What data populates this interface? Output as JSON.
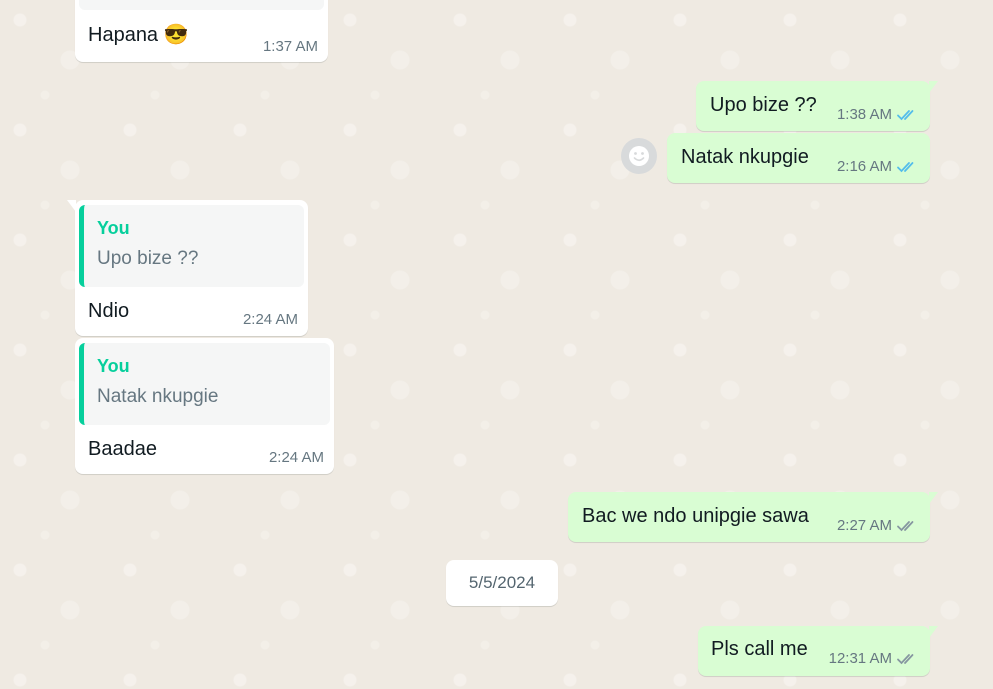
{
  "colors": {
    "background": "#efeae2",
    "incoming_bubble": "#ffffff",
    "outgoing_bubble": "#d9fdd3",
    "read_tick": "#53bdeb",
    "delivered_tick": "#8696a0",
    "quote_accent": "#06cf9c"
  },
  "messages": [
    {
      "direction": "incoming",
      "text": "Hapana 😎",
      "time": "1:37 AM"
    },
    {
      "direction": "outgoing",
      "text": "Upo bize ??",
      "time": "1:38 AM",
      "status": "read"
    },
    {
      "direction": "outgoing",
      "text": "Natak nkupgie",
      "time": "2:16 AM",
      "status": "read"
    },
    {
      "direction": "incoming",
      "quote_author": "You",
      "quote_text": "Upo bize ??",
      "text": "Ndio",
      "time": "2:24 AM"
    },
    {
      "direction": "incoming",
      "quote_author": "You",
      "quote_text": "Natak nkupgie",
      "text": "Baadae",
      "time": "2:24 AM"
    },
    {
      "direction": "outgoing",
      "text": "Bac we ndo unipgie sawa",
      "time": "2:27 AM",
      "status": "delivered"
    },
    {
      "direction": "outgoing",
      "text": "Pls call me",
      "time": "12:31 AM",
      "status": "delivered"
    }
  ],
  "date_separator": "5/5/2024",
  "icons": {
    "reaction": "smiley-icon",
    "read": "double-check-icon",
    "delivered": "double-check-icon"
  }
}
